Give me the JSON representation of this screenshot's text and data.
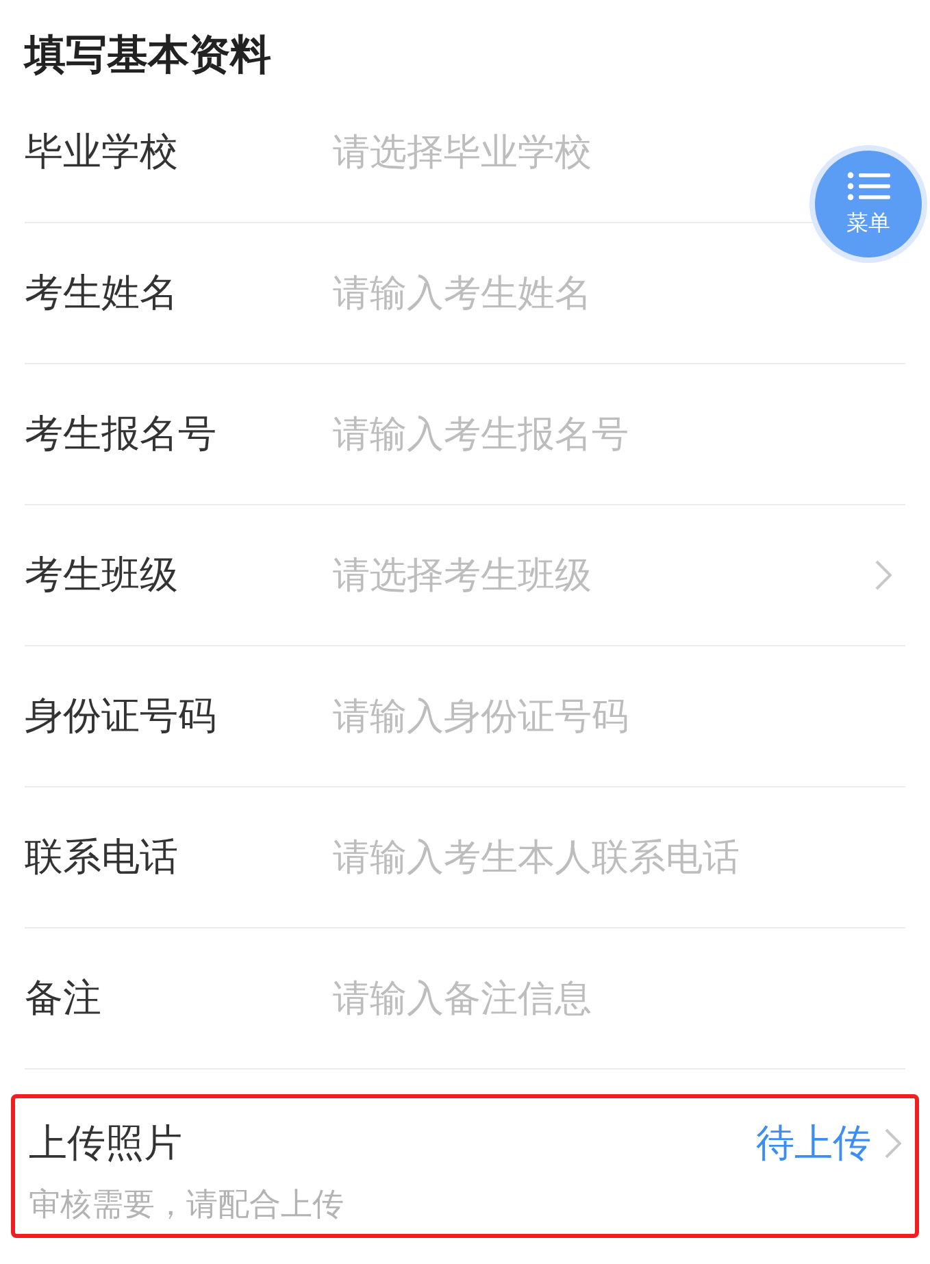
{
  "title": "填写基本资料",
  "fields": [
    {
      "label": "毕业学校",
      "placeholder": "请选择毕业学校",
      "chevron": false
    },
    {
      "label": "考生姓名",
      "placeholder": "请输入考生姓名",
      "chevron": false
    },
    {
      "label": "考生报名号",
      "placeholder": "请输入考生报名号",
      "chevron": false
    },
    {
      "label": "考生班级",
      "placeholder": "请选择考生班级",
      "chevron": true
    },
    {
      "label": "身份证号码",
      "placeholder": "请输入身份证号码",
      "chevron": false
    },
    {
      "label": "联系电话",
      "placeholder": "请输入考生本人联系电话",
      "chevron": false
    },
    {
      "label": "备注",
      "placeholder": "请输入备注信息",
      "chevron": false
    }
  ],
  "upload": {
    "label": "上传照片",
    "status": "待上传",
    "hint": "审核需要，请配合上传",
    "highlighted": true
  },
  "menu_button": {
    "label": "菜单"
  }
}
